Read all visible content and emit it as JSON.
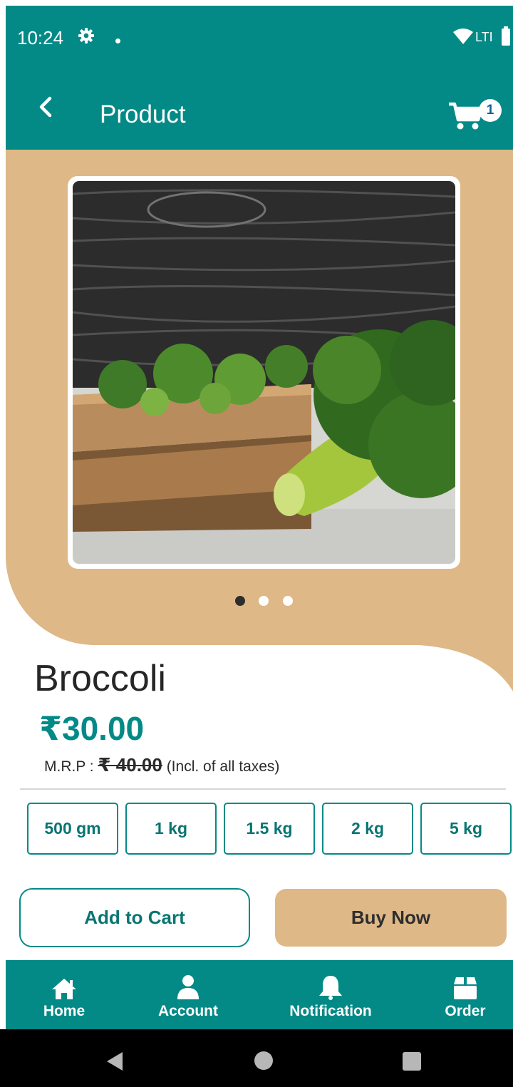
{
  "status_bar": {
    "time": "10:24",
    "network": "LTI"
  },
  "app_bar": {
    "title": "Product",
    "cart_count": "1"
  },
  "product": {
    "name": "Broccoli",
    "price": "₹30.00",
    "mrp_label": "M.R.P : ",
    "mrp_value": "₹ 40.00",
    "tax_note": " (Incl. of all taxes)",
    "image_pages": 3,
    "active_image_index": 0
  },
  "weights": [
    "500 gm",
    "1 kg",
    "1.5 kg",
    "2 kg",
    "5 kg"
  ],
  "actions": {
    "add_to_cart": "Add to Cart",
    "buy_now": "Buy Now"
  },
  "bottom_nav": [
    {
      "label": "Home",
      "icon": "home-icon"
    },
    {
      "label": "Account",
      "icon": "account-icon"
    },
    {
      "label": "Notification",
      "icon": "bell-icon"
    },
    {
      "label": "Order",
      "icon": "order-box-icon"
    }
  ],
  "colors": {
    "primary": "#038a87",
    "accent": "#deb887"
  }
}
